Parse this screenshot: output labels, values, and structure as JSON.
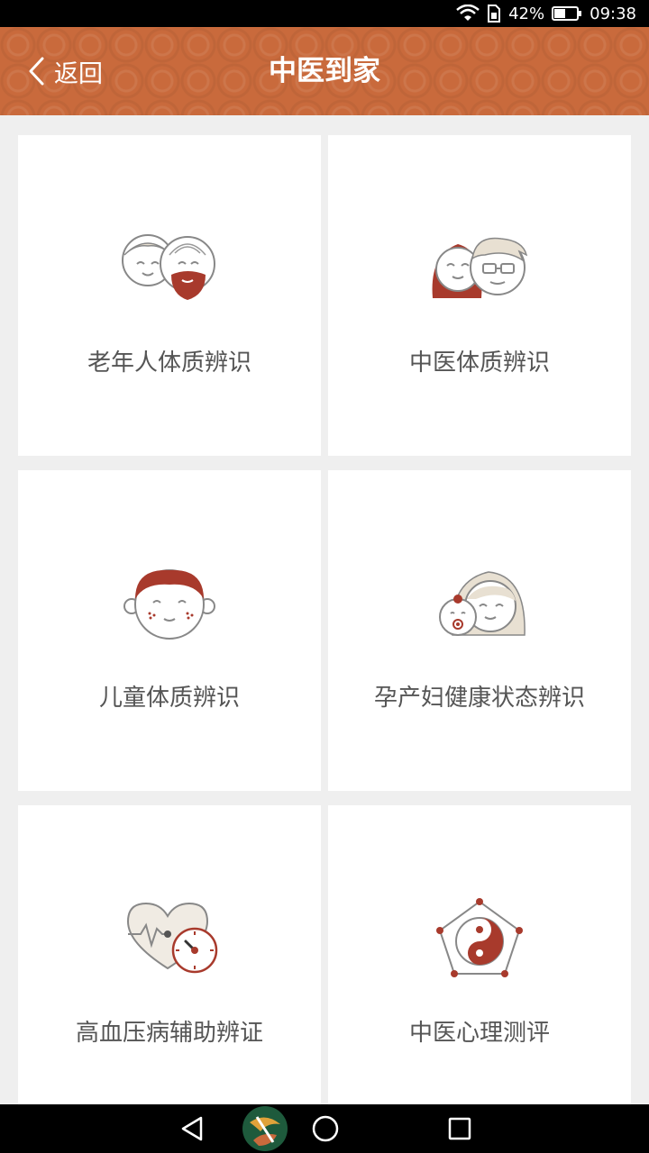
{
  "status_bar": {
    "battery": "42%",
    "time": "09:38",
    "icons": [
      "wifi-icon",
      "sim-icon",
      "battery-icon"
    ]
  },
  "header": {
    "back_label": "返回",
    "title": "中医到家",
    "background_color": "#c96a3c"
  },
  "cards": [
    {
      "label": "老年人体质辨识",
      "icon": "elderly-couple-icon"
    },
    {
      "label": "中医体质辨识",
      "icon": "couple-faces-icon"
    },
    {
      "label": "儿童体质辨识",
      "icon": "child-face-icon"
    },
    {
      "label": "孕产妇健康状态辨识",
      "icon": "mother-baby-icon"
    },
    {
      "label": "高血压病辅助辨证",
      "icon": "heart-gauge-icon"
    },
    {
      "label": "中医心理测评",
      "icon": "yin-yang-pentagon-icon"
    }
  ],
  "nav_bar": {
    "icons": [
      "back-triangle-icon",
      "app-logo-icon",
      "home-circle-icon",
      "recents-square-icon"
    ]
  },
  "colors": {
    "accent": "#a83a2c",
    "line": "#888888",
    "card_bg": "#ffffff",
    "page_bg": "#efefef"
  }
}
